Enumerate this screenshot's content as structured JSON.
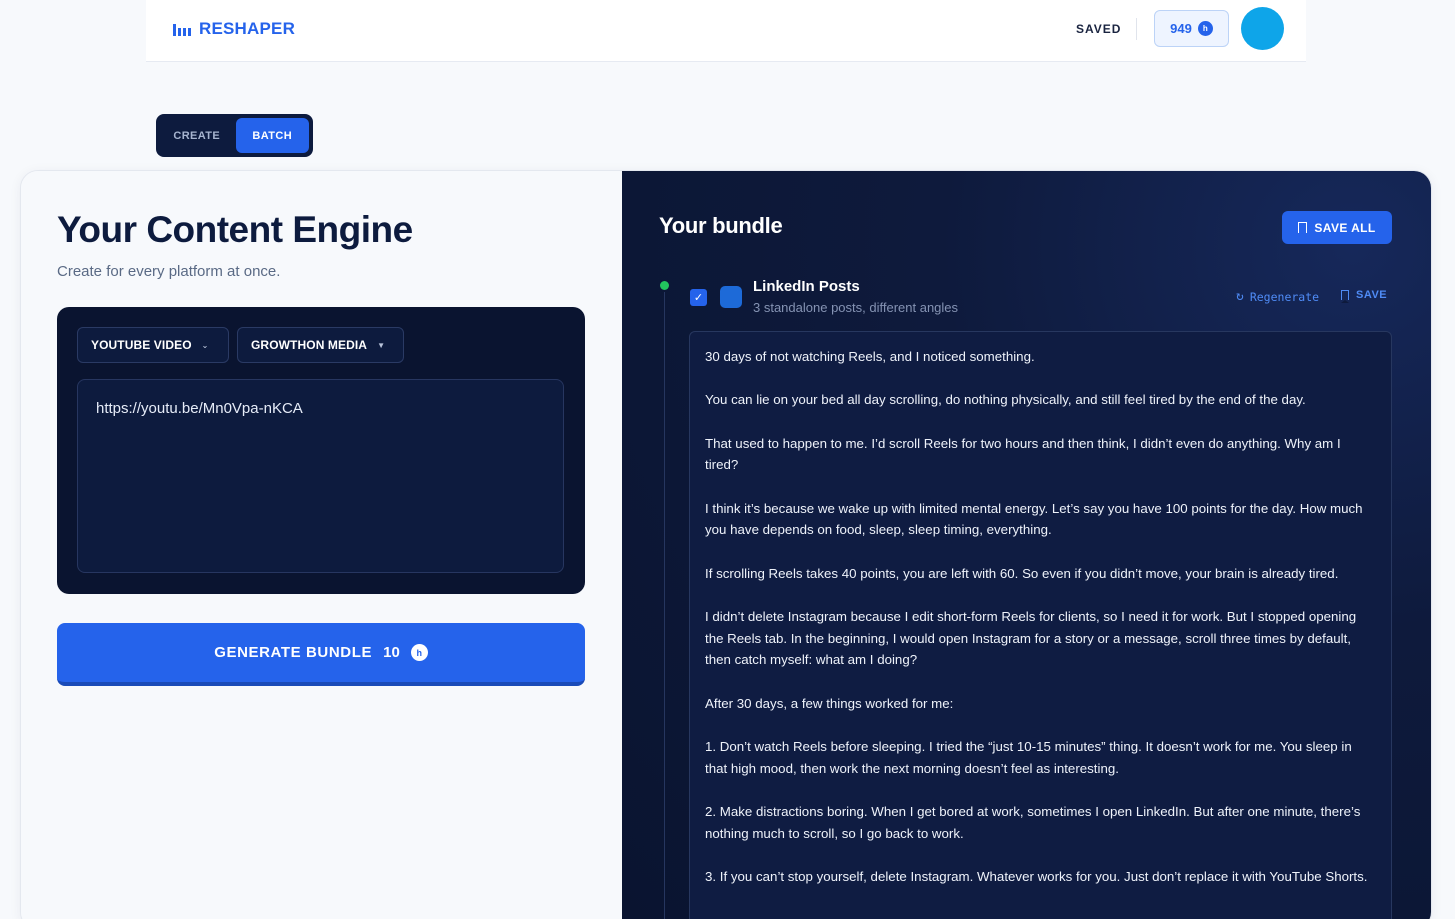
{
  "header": {
    "brand": "RESHAPER",
    "saved_label": "SAVED",
    "credits": "949",
    "coin_glyph": "h"
  },
  "mode": {
    "tabs": [
      "CREATE",
      "BATCH"
    ],
    "active": "BATCH"
  },
  "left": {
    "title": "Your Content Engine",
    "subtitle": "Create for every platform at once.",
    "source_type": "YOUTUBE VIDEO",
    "brand_profile": "GROWTHON MEDIA",
    "url_value": "https://youtu.be/Mn0Vpa-nKCA",
    "generate_label": "GENERATE BUNDLE",
    "generate_cost": "10"
  },
  "bundle": {
    "title": "Your bundle",
    "save_all_label": "SAVE ALL",
    "section": {
      "title": "LinkedIn Posts",
      "description": "3 standalone posts, different angles",
      "regenerate_label": "Regenerate",
      "save_label": "SAVE",
      "checked": true,
      "paragraphs": [
        "30 days of not watching Reels, and I noticed something.",
        "You can lie on your bed all day scrolling, do nothing physically, and still feel tired by the end of the day.",
        "That used to happen to me. I’d scroll Reels for two hours and then think, I didn’t even do anything. Why am I tired?",
        "I think it’s because we wake up with limited mental energy. Let’s say you have 100 points for the day. How much you have depends on food, sleep, sleep timing, everything.",
        "If scrolling Reels takes 40 points, you are left with 60. So even if you didn’t move, your brain is already tired.",
        "I didn’t delete Instagram because I edit short-form Reels for clients, so I need it for work. But I stopped opening the Reels tab. In the beginning, I would open Instagram for a story or a message, scroll three times by default, then catch myself: what am I doing?",
        "After 30 days, a few things worked for me:",
        "1. Don’t watch Reels before sleeping. I tried the “just 10-15 minutes” thing. It doesn’t work for me. You sleep in that high mood, then work the next morning doesn’t feel as interesting.",
        "2. Make distractions boring. When I get bored at work, sometimes I open LinkedIn. But after one minute, there’s nothing much to scroll, so I go back to work.",
        "3. If you can’t stop yourself, delete Instagram. Whatever works for you. Just don’t replace it with YouTube Shorts."
      ]
    }
  },
  "colors": {
    "accent": "#2563eb",
    "navy": "#0d1b3e",
    "status_dot": "#22c55e",
    "avatar": "#0ea5e9"
  }
}
